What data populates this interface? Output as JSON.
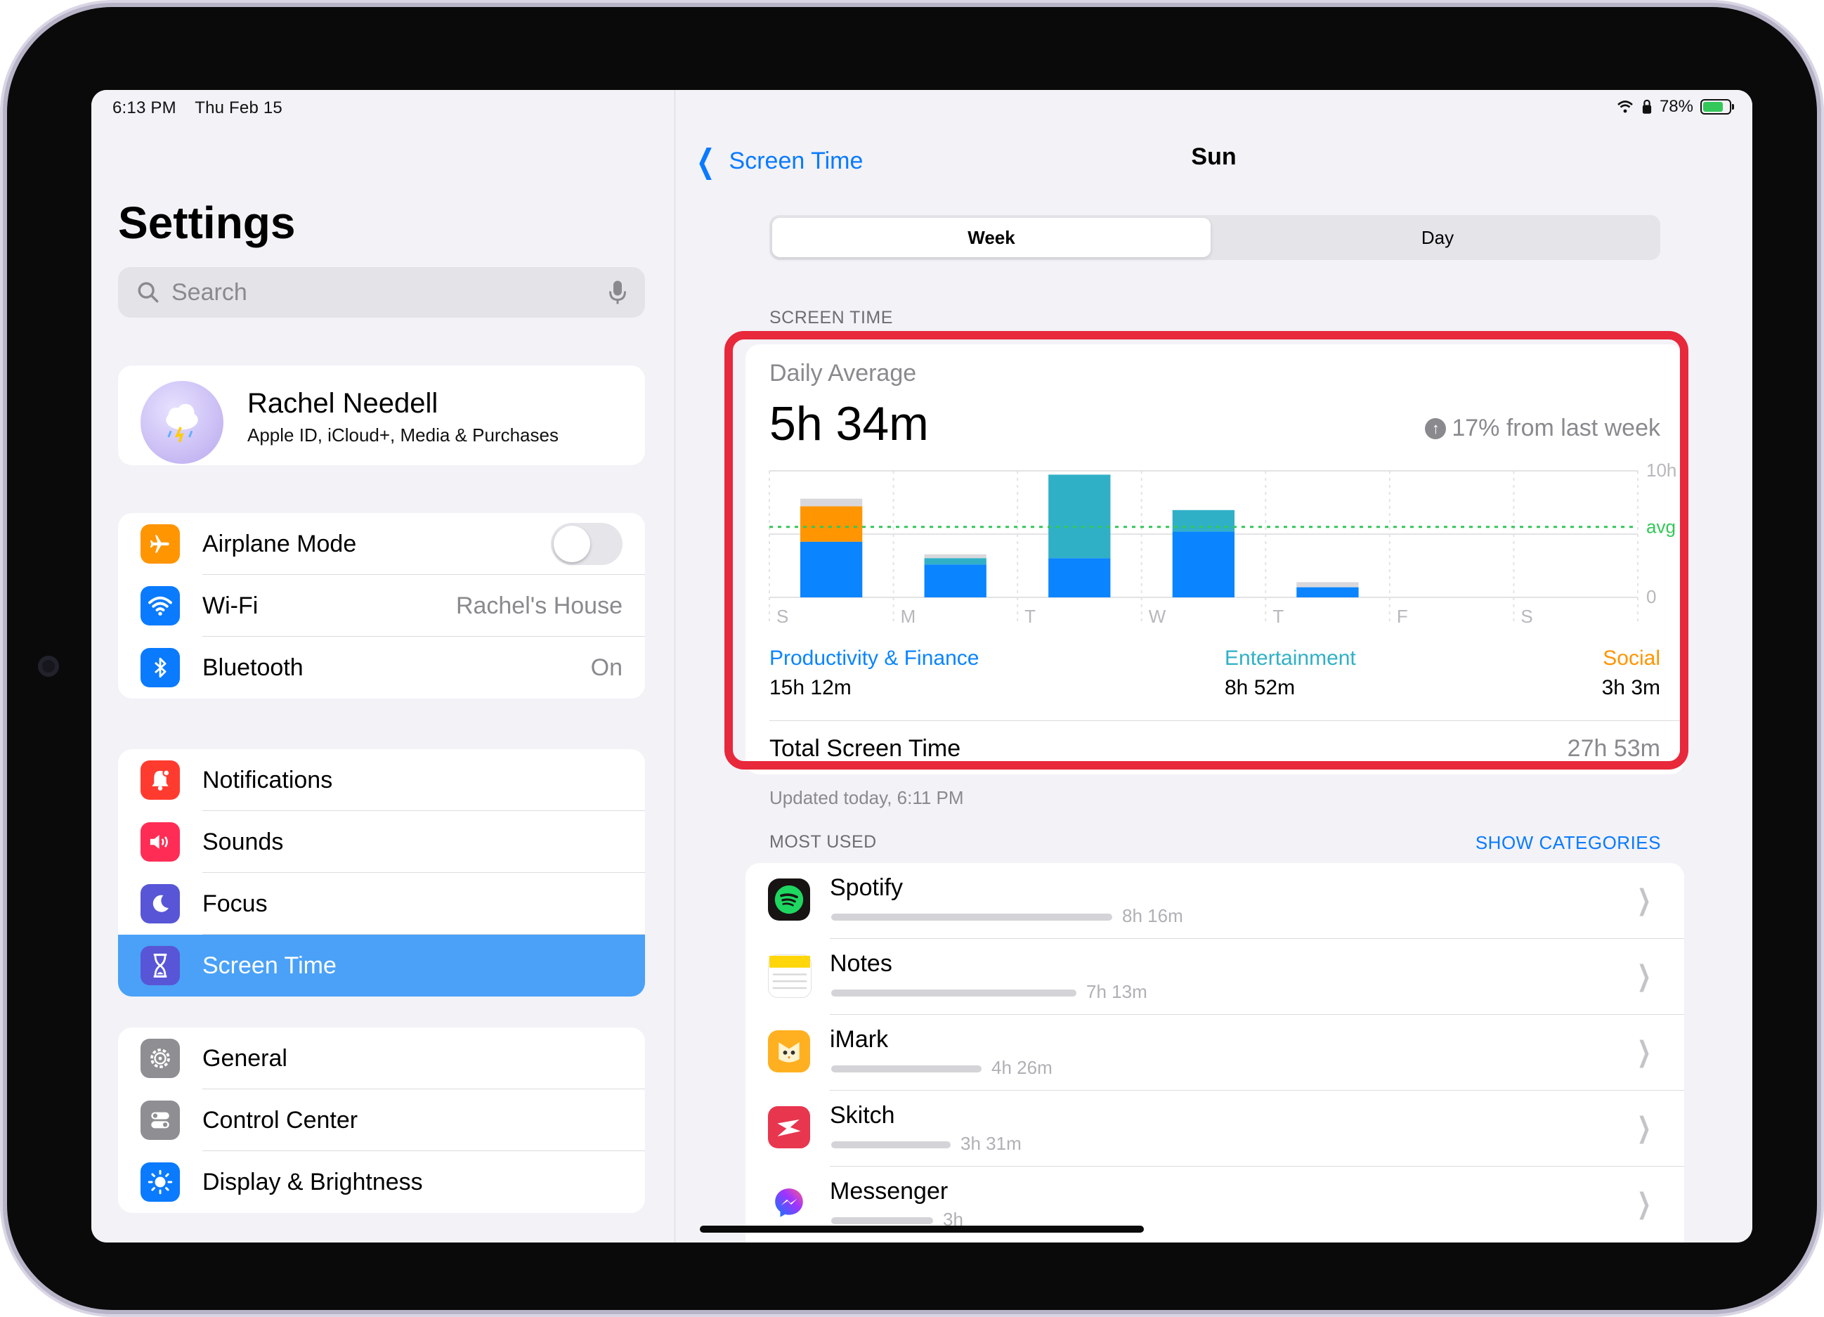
{
  "status": {
    "time": "6:13 PM",
    "date": "Thu Feb 15",
    "battery": "78%"
  },
  "sidebar": {
    "title": "Settings",
    "search_placeholder": "Search",
    "profile": {
      "name": "Rachel Needell",
      "subtitle": "Apple ID, iCloud+, Media & Purchases"
    },
    "group1": [
      {
        "label": "Airplane Mode",
        "icon": "airplane-icon",
        "color": "#ff9500",
        "toggle": false
      },
      {
        "label": "Wi-Fi",
        "icon": "wifi-icon",
        "color": "#0a7aff",
        "value": "Rachel's House"
      },
      {
        "label": "Bluetooth",
        "icon": "bluetooth-icon",
        "color": "#0a7aff",
        "value": "On"
      }
    ],
    "group2": [
      {
        "label": "Notifications",
        "icon": "bell-icon",
        "color": "#ff3b30"
      },
      {
        "label": "Sounds",
        "icon": "speaker-icon",
        "color": "#ff2d55"
      },
      {
        "label": "Focus",
        "icon": "moon-icon",
        "color": "#5856d6"
      },
      {
        "label": "Screen Time",
        "icon": "hourglass-icon",
        "color": "#5856d6",
        "selected": true
      }
    ],
    "group3": [
      {
        "label": "General",
        "icon": "gear-icon",
        "color": "#8e8e93"
      },
      {
        "label": "Control Center",
        "icon": "switches-icon",
        "color": "#8e8e93"
      },
      {
        "label": "Display & Brightness",
        "icon": "sun-icon",
        "color": "#0a7aff"
      }
    ]
  },
  "detail": {
    "back_label": "Screen Time",
    "title": "Sun",
    "segments": {
      "week": "Week",
      "day": "Day"
    },
    "screen_time_header": "SCREEN TIME",
    "daily_average_label": "Daily Average",
    "daily_average_value": "5h 34m",
    "change_text": "17% from last week",
    "categories": [
      {
        "name": "Productivity & Finance",
        "value": "15h 12m",
        "color": "#0a84ff"
      },
      {
        "name": "Entertainment",
        "value": "8h 52m",
        "color": "#30b0c7"
      },
      {
        "name": "Social",
        "value": "3h 3m",
        "color": "#ff9500"
      }
    ],
    "total_label": "Total Screen Time",
    "total_value": "27h 53m",
    "updated": "Updated today, 6:11 PM",
    "most_used_header": "MOST USED",
    "show_categories": "SHOW CATEGORIES",
    "apps": [
      {
        "name": "Spotify",
        "time": "8h 16m",
        "icon": "spotify-icon",
        "color": "#191414",
        "fraction": 1.0
      },
      {
        "name": "Notes",
        "time": "7h 13m",
        "icon": "notes-icon",
        "color": "#ffd60a",
        "fraction": 0.873
      },
      {
        "name": "iMark",
        "time": "4h 26m",
        "icon": "imark-icon",
        "color": "#ffb020",
        "fraction": 0.536
      },
      {
        "name": "Skitch",
        "time": "3h 31m",
        "icon": "skitch-icon",
        "color": "#e8364f",
        "fraction": 0.425
      },
      {
        "name": "Messenger",
        "time": "3h",
        "icon": "messenger-icon",
        "color": "#ffffff",
        "fraction": 0.363
      }
    ]
  },
  "chart_data": {
    "type": "bar",
    "stacked": true,
    "categories": [
      "S",
      "M",
      "T",
      "W",
      "T",
      "F",
      "S"
    ],
    "series": [
      {
        "name": "Productivity & Finance",
        "color": "#0a84ff",
        "values": [
          4.4,
          2.6,
          3.1,
          5.2,
          0.8,
          0,
          0
        ]
      },
      {
        "name": "Entertainment",
        "color": "#30b0c7",
        "values": [
          0,
          0.5,
          6.6,
          1.7,
          0,
          0,
          0
        ]
      },
      {
        "name": "Social",
        "color": "#ff9500",
        "values": [
          2.8,
          0,
          0,
          0,
          0,
          0,
          0
        ]
      },
      {
        "name": "Other",
        "color": "#d8d8dc",
        "values": [
          0.6,
          0.3,
          0,
          0,
          0.4,
          0,
          0
        ]
      }
    ],
    "y_ticks": [
      "10h",
      "avg",
      "0"
    ],
    "ylim": [
      0,
      10
    ],
    "average": 5.57
  }
}
